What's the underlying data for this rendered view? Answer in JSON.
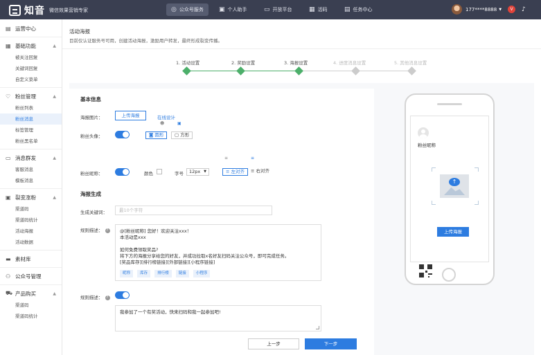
{
  "app": {
    "name": "知音",
    "tagline": "微信效果营销专家"
  },
  "topnav": [
    {
      "label": "公众号服务",
      "icon": "wechat-icon",
      "glyph": "◎"
    },
    {
      "label": "个人助手",
      "icon": "briefcase-icon",
      "glyph": "▣"
    },
    {
      "label": "开放平台",
      "icon": "monitor-icon",
      "glyph": "▭"
    },
    {
      "label": "活码",
      "icon": "qrcode-icon",
      "glyph": "▦"
    },
    {
      "label": "任务中心",
      "icon": "task-icon",
      "glyph": "▤"
    }
  ],
  "user": {
    "phone": "177****8888",
    "vip": "V"
  },
  "sidebar": {
    "ops": "运营中心",
    "basic": {
      "title": "基础功能",
      "items": [
        "被关注回复",
        "关键词回复",
        "自定义菜单"
      ]
    },
    "fans": {
      "title": "粉丝管理",
      "items": [
        "粉丝列表",
        "粉丝消息",
        "标签管理",
        "粉丝黑名单"
      ]
    },
    "mass": {
      "title": "消息群发",
      "items": [
        "客服消息",
        "模板消息"
      ]
    },
    "viral": {
      "title": "裂变涨粉",
      "items": [
        "渠道码",
        "渠道码统计",
        "活动海报",
        "活动数据"
      ]
    },
    "material": "素材库",
    "official": "公众号管理",
    "product": {
      "title": "产品购买",
      "items": [
        "渠道码",
        "渠道码统计"
      ]
    }
  },
  "page": {
    "title": "活动海报",
    "desc": "目前仅认证服务号可用，创建活动海报，激励用户转发，最终形成裂变传播。"
  },
  "steps": [
    "1. 活动设置",
    "2. 奖励设置",
    "3. 海报设置",
    "4. 进度消息设置",
    "5. 其他消息设置"
  ],
  "basic_info": {
    "title": "基本信息",
    "poster_label": "海报图片：",
    "upload": "上传海报",
    "online": "在线设计",
    "avatar_label": "粉丝头像：",
    "round": "圆形",
    "square": "方形",
    "nick_label": "粉丝昵称：",
    "color": "颜色",
    "font_size": "字号",
    "font_value": "12px",
    "align_left": "左对齐",
    "align_right": "右对齐"
  },
  "poster_gen": {
    "title": "海报生成",
    "keyword_label": "生成关键词：",
    "keyword_placeholder": "最10个字符",
    "rule_label": "规则描述：",
    "rule_lines": [
      "@[粉丝昵称] 您好！欢迎关注xxx！",
      "本活动是xxx",
      "",
      "如何免费领取奖品?",
      "将下方的海报分享给您的好友，并成功拉取x名好友扫码关注公众号，即可完成任务。",
      "[奖品库存][排行榜链接][外部链接][小程序链接]"
    ],
    "tags": [
      "昵称",
      "库存",
      "排行榜",
      "链接",
      "小程序"
    ],
    "share_label": "规则描述：",
    "share_text": "我参加了一个有奖活动，快来扫码和我一起参加吧!"
  },
  "preview": {
    "nickname": "粉丝昵称",
    "upload_btn": "上传海报"
  },
  "footer": {
    "prev": "上一步",
    "next": "下一步"
  },
  "colors": {
    "topbar": "#3a3f51",
    "primary": "#2d7ce0",
    "step_done": "#4caf6a"
  }
}
